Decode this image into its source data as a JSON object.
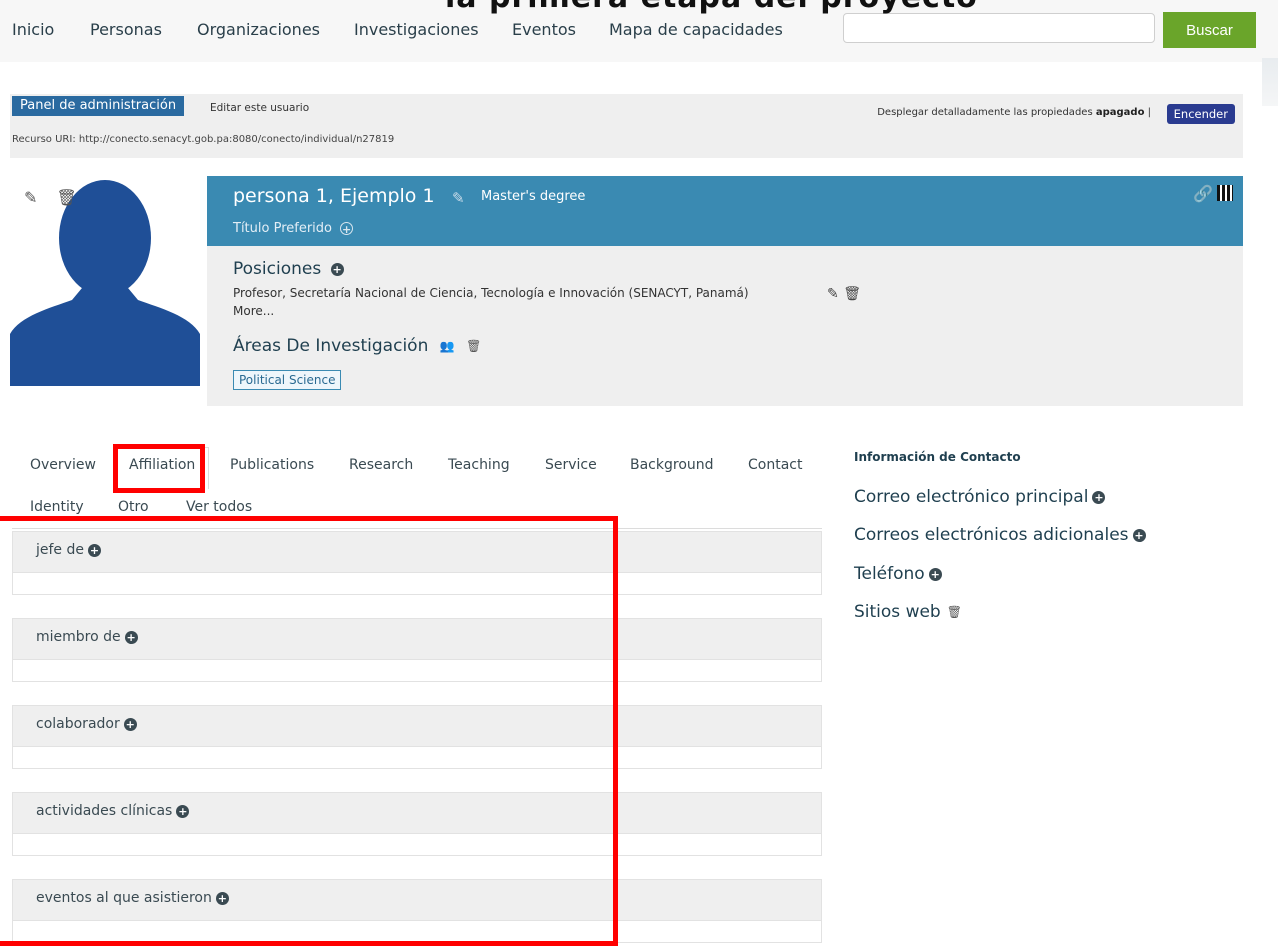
{
  "banner": {
    "text": "la primera etapa del proyecto"
  },
  "nav": {
    "items": [
      "Inicio",
      "Personas",
      "Organizaciones",
      "Investigaciones",
      "Eventos",
      "Mapa de capacidades"
    ],
    "search_placeholder": "",
    "search_button": "Buscar"
  },
  "admin": {
    "badge": "Panel de administración",
    "edit_user": "Editar este usuario",
    "uri": "Recurso URI: http://conecto.senacyt.gob.pa:8080/conecto/individual/n27819",
    "props_prefix": "Desplegar detalladamente las propiedades",
    "props_state": "apagado",
    "props_sep": "|",
    "props_button": "Encender"
  },
  "profile": {
    "name": "persona 1, Ejemplo 1",
    "degree": "Master's degree",
    "preferred_title": "Título Preferido",
    "positions_title": "Posiciones",
    "position_text": "Profesor, Secretaría Nacional de Ciencia, Tecnología e Innovación (SENACYT, Panamá)",
    "more": "More...",
    "areas_title": "Áreas De Investigación",
    "area_tag": "Political Science"
  },
  "tabs": {
    "row1": [
      "Overview",
      "Affiliation",
      "Publications",
      "Research",
      "Teaching",
      "Service",
      "Background",
      "Contact"
    ],
    "row2": [
      "Identity",
      "Otro",
      "Ver todos"
    ],
    "active": "Affiliation"
  },
  "sections": [
    "jefe de",
    "miembro de",
    "colaborador",
    "actividades clínicas",
    "eventos al que asistieron"
  ],
  "contact": {
    "title": "Información de Contacto",
    "items": [
      "Correo electrónico principal",
      "Correos electrónicos adicionales",
      "Teléfono",
      "Sitios web"
    ]
  },
  "colors": {
    "header_blue": "#3a8ab2",
    "search_green": "#6aa52a",
    "admin_badge": "#2a6aa0",
    "encender": "#2a3b90",
    "highlight_red": "#ff0000",
    "silhouette": "#1f4f97"
  },
  "icons": [
    "pencil-icon",
    "trash-icon",
    "plus-circle-icon",
    "link-icon",
    "qr-code-icon",
    "people-icon"
  ]
}
